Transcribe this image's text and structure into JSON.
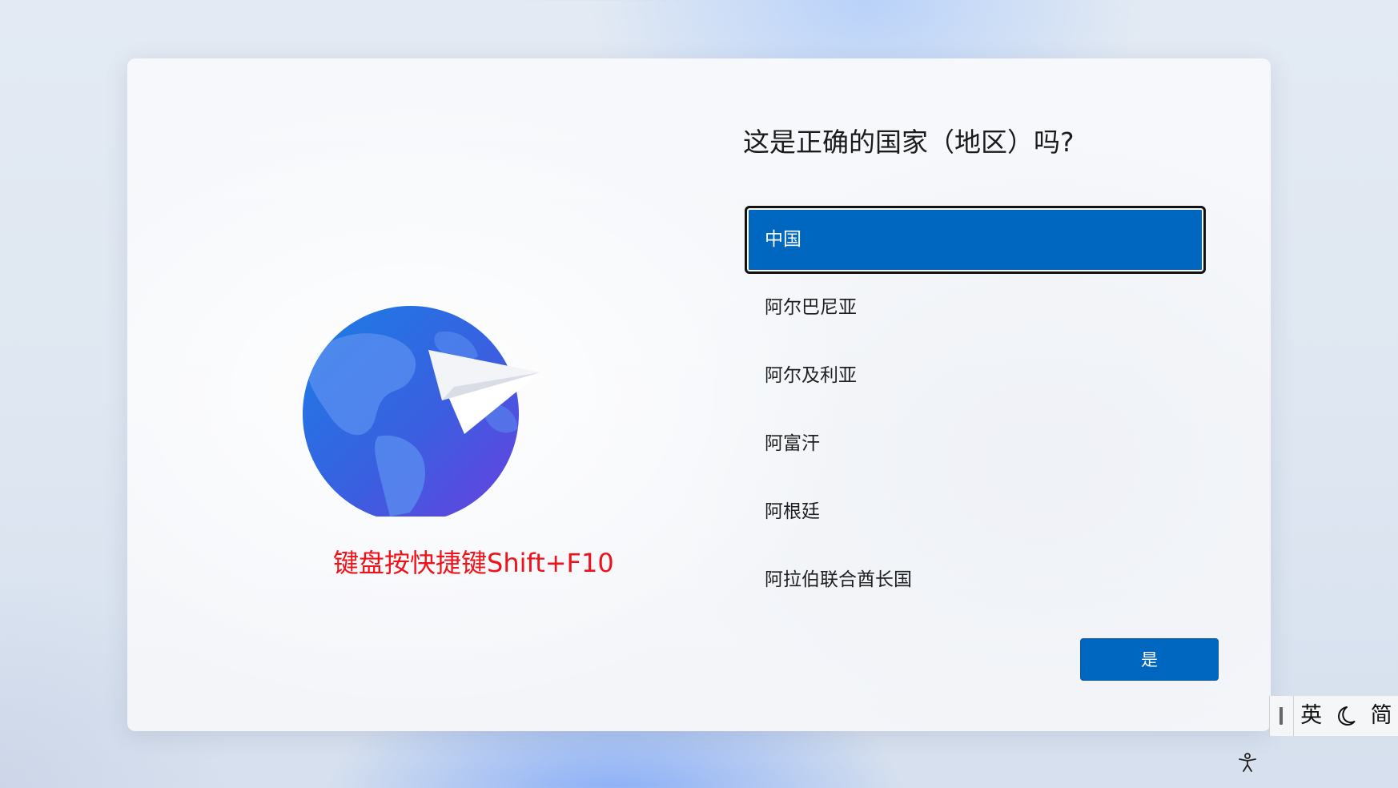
{
  "setup": {
    "title": "这是正确的国家（地区）吗?",
    "hint": "键盘按快捷键Shift+F10",
    "countries": [
      {
        "label": "中国",
        "selected": true
      },
      {
        "label": "阿尔巴尼亚",
        "selected": false
      },
      {
        "label": "阿尔及利亚",
        "selected": false
      },
      {
        "label": "阿富汗",
        "selected": false
      },
      {
        "label": "阿根廷",
        "selected": false
      },
      {
        "label": "阿拉伯联合酋长国",
        "selected": false
      }
    ],
    "yes_label": "是"
  },
  "ime": {
    "mode_label": "英",
    "script_label": "简",
    "moon_icon": "half-width-moon-icon"
  },
  "icons": {
    "globe": "globe-paper-plane-icon",
    "accessibility": "accessibility-icon"
  },
  "colors": {
    "accent": "#0067c0",
    "hint_text": "#f0121a"
  }
}
